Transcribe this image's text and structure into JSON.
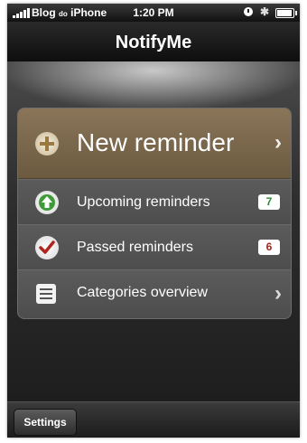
{
  "status_bar": {
    "carrier_main": "Blog",
    "carrier_small": "do",
    "carrier_device": "iPhone",
    "time": "1:20 PM"
  },
  "nav": {
    "title": "NotifyMe"
  },
  "menu": {
    "new_reminder": {
      "label": "New reminder",
      "icon": "plus-icon"
    },
    "items": [
      {
        "label": "Upcoming reminders",
        "badge": "7",
        "badge_color": "#2a8a2a",
        "icon": "green-up-arrow-icon"
      },
      {
        "label": "Passed reminders",
        "badge": "6",
        "badge_color": "#a8221e",
        "icon": "red-checkmark-icon"
      },
      {
        "label": "Categories overview",
        "icon": "list-icon"
      }
    ]
  },
  "toolbar": {
    "settings_label": "Settings"
  },
  "colors": {
    "hero_row": "#7a6749",
    "background": "#1b1b1b"
  }
}
